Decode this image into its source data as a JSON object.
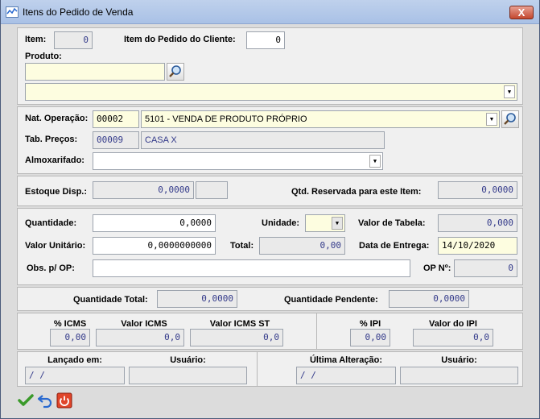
{
  "window": {
    "title": "Itens do Pedido de Venda",
    "close_label": "X"
  },
  "item": {
    "label": "Item:",
    "value": "0",
    "client_label": "Item do Pedido do Cliente:",
    "client_value": "0"
  },
  "produto": {
    "label": "Produto:",
    "code": "",
    "desc": ""
  },
  "nat": {
    "label": "Nat. Operação:",
    "code": "00002",
    "desc": "5101 - VENDA DE PRODUTO PRÓPRIO"
  },
  "tab": {
    "label": "Tab. Preços:",
    "code": "00009",
    "desc": "CASA X"
  },
  "almox": {
    "label": "Almoxarifado:",
    "value": ""
  },
  "estoque": {
    "label": "Estoque Disp.:",
    "value": "0,0000",
    "unit": "",
    "reserv_label": "Qtd. Reservada para este Item:",
    "reserv_value": "0,0000"
  },
  "qtd": {
    "label": "Quantidade:",
    "value": "0,0000",
    "unidade_label": "Unidade:",
    "unidade_value": "",
    "vtab_label": "Valor de Tabela:",
    "vtab_value": "0,000"
  },
  "vunit": {
    "label": "Valor Unitário:",
    "value": "0,0000000000",
    "total_label": "Total:",
    "total_value": "0,00",
    "entrega_label": "Data de Entrega:",
    "entrega_value": "14/10/2020"
  },
  "obs": {
    "label": "Obs. p/ OP:",
    "value": "",
    "op_label": "OP Nº:",
    "op_value": "0"
  },
  "totais": {
    "qtd_total_label": "Quantidade Total:",
    "qtd_total_value": "0,0000",
    "qtd_pend_label": "Quantidade Pendente:",
    "qtd_pend_value": "0,0000"
  },
  "impostos": {
    "icms_pct_label": "% ICMS",
    "icms_pct_value": "0,00",
    "icms_val_label": "Valor ICMS",
    "icms_val_value": "0,0",
    "icms_st_label": "Valor ICMS ST",
    "icms_st_value": "0,0",
    "ipi_pct_label": "% IPI",
    "ipi_pct_value": "0,00",
    "ipi_val_label": "Valor do IPI",
    "ipi_val_value": "0,0"
  },
  "audit": {
    "lancado_label": "Lançado em:",
    "lancado_value": "/   /",
    "usuario1_label": "Usuário:",
    "usuario1_value": "",
    "alteracao_label": "Última Alteração:",
    "alteracao_value": "/   /",
    "usuario2_label": "Usuário:",
    "usuario2_value": ""
  },
  "colors": {
    "readonly": "#eaeaea",
    "highlight": "#fdfde0",
    "title": "#a9c1e6"
  },
  "icons": [
    "chart-app-icon",
    "search-icon",
    "chevron-down-icon",
    "confirm-check-icon",
    "undo-icon",
    "power-icon"
  ]
}
